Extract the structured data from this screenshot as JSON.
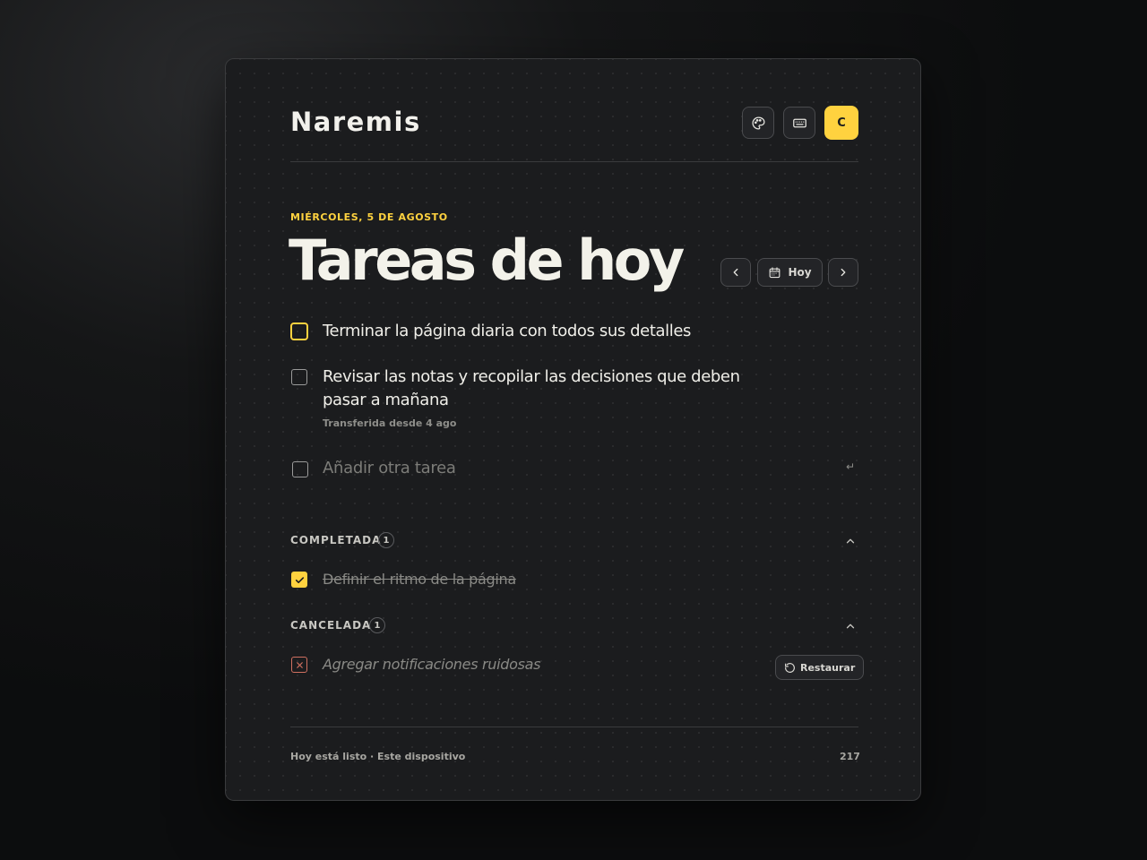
{
  "app": {
    "name": "Naremis",
    "avatar_initial": "C"
  },
  "header": {
    "icons": [
      "palette-icon",
      "keyboard-icon"
    ]
  },
  "date_label": "MIÉRCOLES, 5 DE AGOSTO",
  "title": "Tareas de hoy",
  "date_nav": {
    "today_label": "Hoy"
  },
  "tasks": [
    {
      "text": "Terminar la página diaria con todos sus detalles",
      "note": ""
    },
    {
      "text_line1": "Revisar las notas y recopilar las decisiones que deben",
      "text_line2": "pasar a mañana",
      "note": "Transferida desde 4 ago"
    }
  ],
  "new_task": {
    "placeholder": "Añadir otra tarea",
    "enter_hint": "↵"
  },
  "completed": {
    "label": "COMPLETADA",
    "count": "1",
    "items": [
      "Definir el ritmo de la página"
    ]
  },
  "cancelled": {
    "label": "CANCELADA",
    "count": "1",
    "items": [
      "Agregar notificaciones ruidosas"
    ],
    "restore_label": "Restaurar"
  },
  "footer": {
    "status": "Hoy está listo · Este dispositivo",
    "number": "217"
  },
  "colors": {
    "accent": "#ffd23f",
    "background": "#1b1c1e",
    "cancel": "#d07060"
  }
}
